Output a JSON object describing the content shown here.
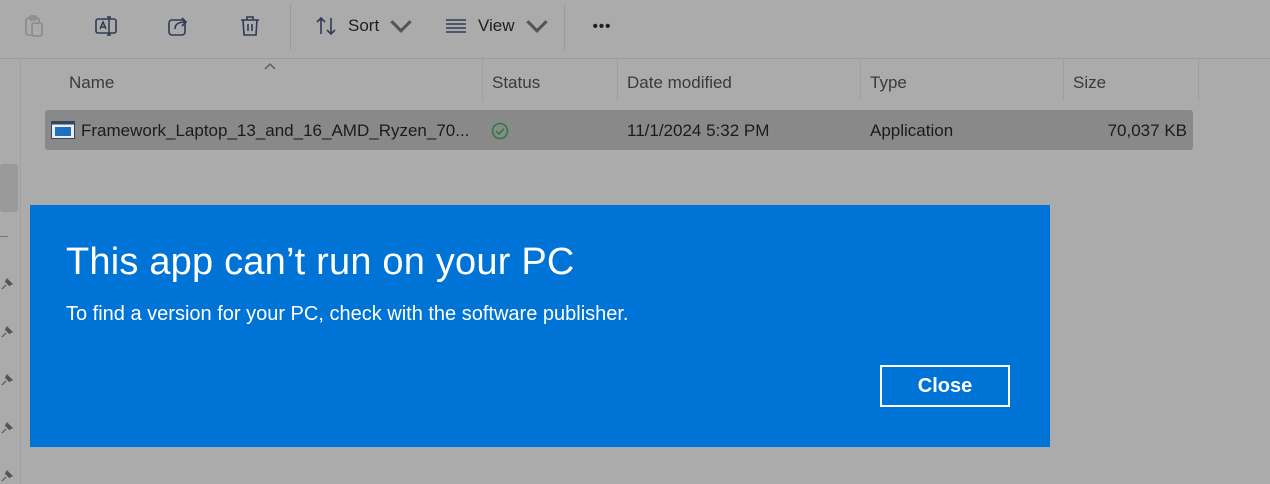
{
  "toolbar": {
    "sort_label": "Sort",
    "view_label": "View",
    "more_label": "•••",
    "icons": [
      "paste-icon",
      "rename-icon",
      "share-icon",
      "delete-icon",
      "sort-icon",
      "view-icon"
    ]
  },
  "columns": {
    "name": "Name",
    "status": "Status",
    "date_modified": "Date modified",
    "type": "Type",
    "size": "Size"
  },
  "file": {
    "name": "Framework_Laptop_13_and_16_AMD_Ryzen_70...",
    "status_icon": "synced-check-icon",
    "date_modified": "11/1/2024 5:32 PM",
    "type": "Application",
    "size": "70,037 KB"
  },
  "dialog": {
    "title": "This app can’t run on your PC",
    "message": "To find a version for your PC, check with the software publisher.",
    "close_label": "Close",
    "background": "#0073d6"
  }
}
